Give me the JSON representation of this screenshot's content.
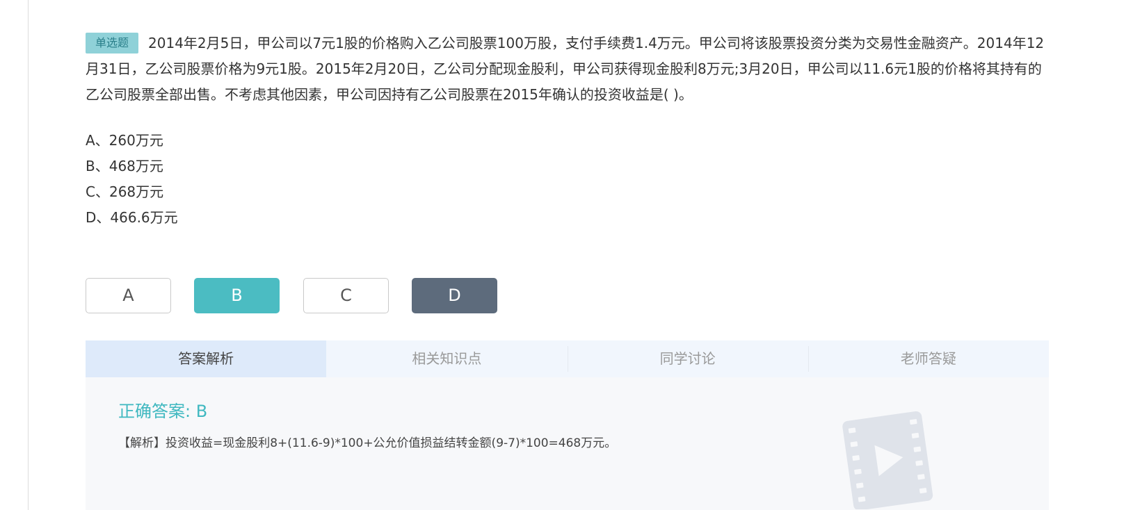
{
  "question": {
    "type_label": "单选题",
    "text": "2014年2月5日，甲公司以7元1股的价格购入乙公司股票100万股，支付手续费1.4万元。甲公司将该股票投资分类为交易性金融资产。2014年12月31日，乙公司股票价格为9元1股。2015年2月20日，乙公司分配现金股利，甲公司获得现金股利8万元;3月20日，甲公司以11.6元1股的价格将其持有的乙公司股票全部出售。不考虑其他因素，甲公司因持有乙公司股票在2015年确认的投资收益是( )。",
    "options": [
      "A、260万元",
      "B、468万元",
      "C、268万元",
      "D、466.6万元"
    ]
  },
  "answer_buttons": [
    {
      "label": "A",
      "state": "default"
    },
    {
      "label": "B",
      "state": "selected"
    },
    {
      "label": "C",
      "state": "default"
    },
    {
      "label": "D",
      "state": "dark"
    }
  ],
  "tabs": [
    {
      "label": "答案解析",
      "active": true
    },
    {
      "label": "相关知识点",
      "active": false
    },
    {
      "label": "同学讨论",
      "active": false
    },
    {
      "label": "老师答疑",
      "active": false
    }
  ],
  "analysis": {
    "correct_answer": "正确答案: B",
    "explanation": "【解析】投资收益=现金股利8+(11.6-9)*100+公允价值损益结转金额(9-7)*100=468万元。",
    "icon": "video-play-icon"
  },
  "colors": {
    "accent_teal": "#4bbcc2",
    "dark_slate": "#5d6b7c",
    "badge_bg": "#8fd1d8",
    "tab_bar_bg": "#f1f6fd",
    "tab_active_bg": "#deeafa"
  }
}
